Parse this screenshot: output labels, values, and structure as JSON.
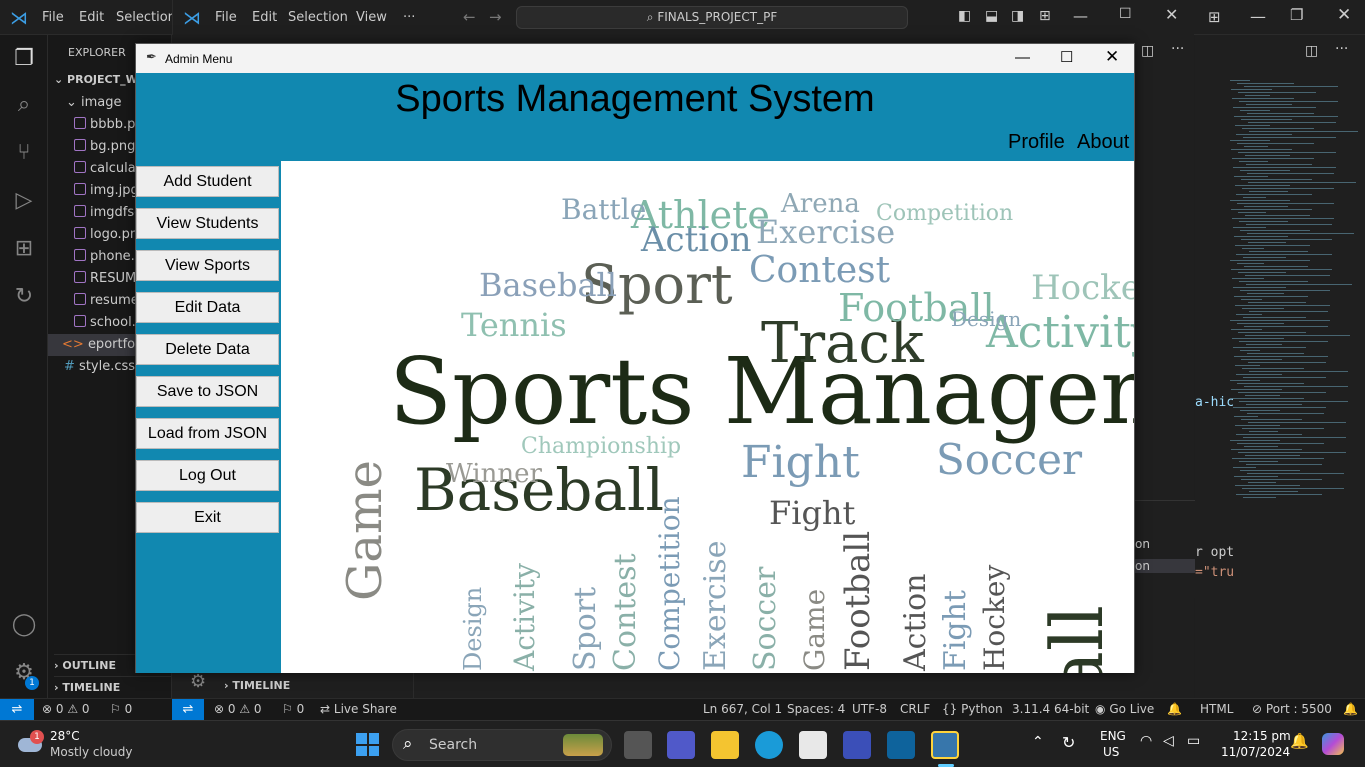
{
  "back_vscode": {
    "menu": [
      "File",
      "Edit",
      "Selection"
    ],
    "explorer_label": "EXPLORER",
    "project": "PROJECT_WE",
    "folder": "image",
    "files": [
      "bbbb.pr",
      "bg.png",
      "calculat",
      "img.jpg",
      "imgdfsd",
      "logo.pn",
      "phone.p",
      "RESUMI",
      "resume.",
      "school.j"
    ],
    "selected_file": "eportfolio",
    "css_file": "style.css",
    "outline": "OUTLINE",
    "timeline": "TIMELINE",
    "badge": "1",
    "status_left": [
      "⊗ 0 ⚠ 0",
      "⚐ 0"
    ]
  },
  "vs2": {
    "menu": [
      "File",
      "Edit",
      "Selection",
      "View",
      "···"
    ],
    "search": "FINALS_PROJECT_PF",
    "timeline": "TIMELINE",
    "status": {
      "errors": "⊗ 0 ⚠ 0",
      "ports": "⚐ 0",
      "liveshare": "Live Share",
      "position": "Ln 667, Col 1",
      "spaces": "Spaces: 4",
      "encoding": "UTF-8",
      "eol": "CRLF",
      "language": "Python",
      "version": "3.11.4 64-bit",
      "golive": "Go Live",
      "html": "HTML",
      "port": "Port : 5500"
    },
    "code_fragments": [
      "a-hic",
      "on",
      "on",
      "r opt",
      "=\"tru"
    ]
  },
  "admin": {
    "window_title": "Admin Menu",
    "app_title": "Sports Management System",
    "profile": "Profile",
    "about": "About",
    "buttons": [
      "Add Student",
      "View Students",
      "View Sports",
      "Edit Data",
      "Delete Data",
      "Save to JSON",
      "Load from JSON",
      "Log Out",
      "Exit"
    ]
  },
  "taskbar": {
    "temp": "28°C",
    "weather": "Mostly cloudy",
    "search": "Search",
    "lang1": "ENG",
    "lang2": "US",
    "time": "12:15 pm",
    "date": "11/07/2024"
  },
  "wordcloud": [
    {
      "t": "Sports Management",
      "c": "#1d2b16"
    },
    {
      "t": "Sport",
      "c": "#5b5f55"
    },
    {
      "t": "Athlete",
      "c": "#7fb8a5"
    },
    {
      "t": "Battle",
      "c": "#8aa5b8"
    },
    {
      "t": "Arena",
      "c": "#8fa8b5"
    },
    {
      "t": "Competition",
      "c": "#9ec4b8"
    },
    {
      "t": "Action",
      "c": "#6b8fa8"
    },
    {
      "t": "Exercise",
      "c": "#8fa8b8"
    },
    {
      "t": "Contest",
      "c": "#7b9bb5"
    },
    {
      "t": "Baseball",
      "c": "#8aa0b8"
    },
    {
      "t": "Track",
      "c": "#2f3d2a"
    },
    {
      "t": "Football",
      "c": "#7fb8a5"
    },
    {
      "t": "Hockey",
      "c": "#9ec4b8"
    },
    {
      "t": "Activity",
      "c": "#7fb8a5"
    },
    {
      "t": "Tennis",
      "c": "#8fc0b0"
    },
    {
      "t": "Design",
      "c": "#8aa5b8"
    },
    {
      "t": "Game",
      "c": "#8a8a84"
    },
    {
      "t": "Baseball",
      "c": "#2c3a26"
    },
    {
      "t": "Fight",
      "c": "#7b9bb5"
    },
    {
      "t": "Soccer",
      "c": "#7b9bb5"
    },
    {
      "t": "Ball",
      "c": "#2c3a26"
    },
    {
      "t": "Championship",
      "c": "#a0c8bb"
    },
    {
      "t": "Winner",
      "c": "#9a9a94"
    },
    {
      "t": "Fight",
      "c": "#555"
    }
  ]
}
